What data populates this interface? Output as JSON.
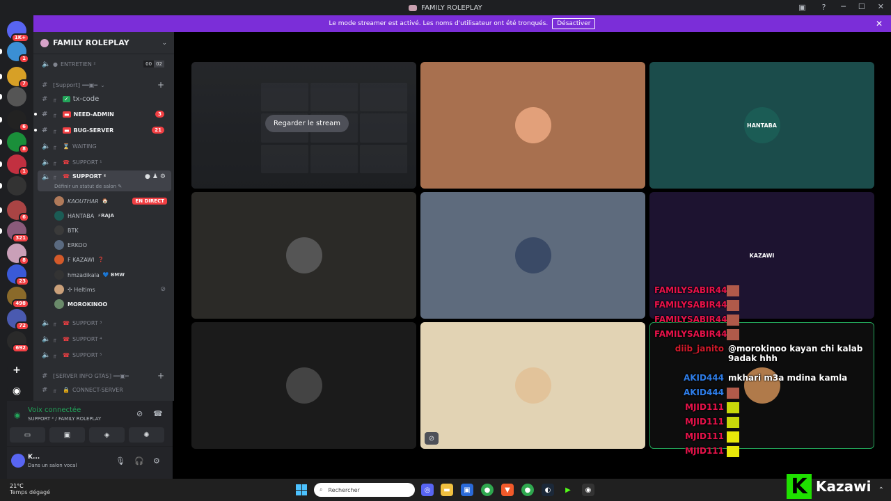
{
  "window": {
    "title": "FAMILY ROLEPLAY"
  },
  "banner": {
    "text": "Le mode streamer est activé. Les noms d'utilisateur ont été tronqués.",
    "button": "Désactiver"
  },
  "rail": {
    "servers": [
      {
        "name": "discord-home",
        "badge": "1K+",
        "color": "#5865f2"
      },
      {
        "name": "server-1",
        "badge": "1",
        "color": "#3b8fd4"
      },
      {
        "name": "server-bn",
        "badge": "7",
        "color": "#d7a026"
      },
      {
        "name": "server-3",
        "badge": "",
        "color": "#555"
      },
      {
        "name": "server-4",
        "badge": "6",
        "color": "#222"
      },
      {
        "name": "server-5",
        "badge": "8",
        "color": "#1a8f3a"
      },
      {
        "name": "server-6",
        "badge": "1",
        "color": "#c23040"
      },
      {
        "name": "server-7",
        "badge": "",
        "color": "#333"
      },
      {
        "name": "server-8",
        "badge": "6",
        "color": "#a44"
      },
      {
        "name": "server-9",
        "badge": "321",
        "color": "#8a5a7a"
      },
      {
        "name": "server-10",
        "badge": "8",
        "color": "#caa0b8"
      },
      {
        "name": "server-11",
        "badge": "23",
        "color": "#3a5ad8"
      },
      {
        "name": "server-12",
        "badge": "498",
        "color": "#8a6a2a"
      },
      {
        "name": "server-13",
        "badge": "72",
        "color": "#4a5ab0"
      },
      {
        "name": "server-14",
        "badge": "692",
        "color": "#2a2a2a"
      }
    ]
  },
  "sidebar": {
    "guild_name": "FAMILY ROLEPLAY",
    "channels": {
      "entretien": "ENTRETIEN ²",
      "entretien_count_a": "00",
      "entretien_count_b": "02",
      "support_category": "⟦Support⟧ ━━▣━",
      "txcode": "tx-code",
      "need_admin": "NEED-ADMIN",
      "need_admin_badge": "3",
      "bug_server": "BUG-SERVER",
      "bug_server_badge": "21",
      "waiting": "WAITING",
      "support1": "SUPPORT ¹",
      "support2": "SUPPORT ²",
      "support2_status": "Définir un statut de salon ✎",
      "support3": "SUPPORT ³",
      "support4": "SUPPORT ⁴",
      "support5": "SUPPORT ⁵",
      "server_info_category": "⟦SERVER INFO GTAS⟧ ━━▣━",
      "connect_server": "CONNECT-SERVER"
    },
    "voice_users": [
      {
        "name": "𝘒𝘈𝘖𝘜𝘛𝘏𝘈𝘙",
        "tag": "🏠",
        "live": "EN DIRECT",
        "color": "#b07a5a"
      },
      {
        "name": "HANTABA",
        "tag": "⚡RAJA",
        "color": "#1b5c55"
      },
      {
        "name": "BTK",
        "tag": "",
        "color": "#3a3a3a"
      },
      {
        "name": "ERKOO",
        "tag": "",
        "color": "#5a6a80"
      },
      {
        "name": "F KAZAWI",
        "tag": "❓",
        "color": "#d45a2a"
      },
      {
        "name": "hmzadikala",
        "tag": "💙 BMW",
        "color": "#333"
      },
      {
        "name": "✣ Heltims",
        "tag": "",
        "color": "#caa07a",
        "muted": true
      },
      {
        "name": "MOROKINOO",
        "tag": "",
        "color": "#6a8a6a",
        "bold": true
      }
    ]
  },
  "voice_panel": {
    "status": "Voix connectée",
    "location": "SUPPORT ² / FAMILY ROLEPLAY"
  },
  "user_panel": {
    "name": "K...",
    "status": "Dans un salon vocal"
  },
  "stage": {
    "watch_stream": "Regarder le stream",
    "tiles": [
      {
        "name": "stream-tile",
        "bg": "#1f2124",
        "avatar": ""
      },
      {
        "name": "kaouthar-tile",
        "bg": "#a8704f",
        "avatar": "#e2a07a"
      },
      {
        "name": "hantaba-tile",
        "bg": "#1b4c4b",
        "avatar": "#1b5c55",
        "label": "HANTABA"
      },
      {
        "name": "btk-tile",
        "bg": "#2b2a27",
        "avatar": "#555"
      },
      {
        "name": "erkoo-tile",
        "bg": "#5e6b7d",
        "avatar": "#3a4a66"
      },
      {
        "name": "kazawi-tile",
        "bg": "#1d1330",
        "avatar": "#d45a2a",
        "label": "KAZAWI"
      },
      {
        "name": "hmzadikala-tile",
        "bg": "#1b1b1b",
        "avatar": "#444"
      },
      {
        "name": "heltims-tile",
        "bg": "#e2d3b4",
        "avatar": "#e2c39a"
      },
      {
        "name": "morokinoo-tile",
        "bg": "#0d0d0d",
        "avatar": "#b07a4a"
      }
    ]
  },
  "chat": [
    {
      "name": "FAMILYSABIR44",
      "color": "#e8124a",
      "msg": ""
    },
    {
      "name": "FAMILYSABIR44",
      "color": "#e8124a",
      "msg": ""
    },
    {
      "name": "FAMILYSABIR44",
      "color": "#e8124a",
      "msg": ""
    },
    {
      "name": "FAMILYSABIR44",
      "color": "#e8124a",
      "msg": ""
    },
    {
      "name": "diib_janito",
      "color": "#d01a2a",
      "msg": "@morokinoo kayan chi kalab 9adak hhh"
    },
    {
      "name": "AKID444",
      "color": "#2e7de8",
      "msg": "mkhari m3a mdina kamla"
    },
    {
      "name": "AKID444",
      "color": "#2e7de8",
      "msg": ""
    },
    {
      "name": "MJID111",
      "color": "#e8124a",
      "msg": ""
    },
    {
      "name": "MJID111",
      "color": "#e8124a",
      "msg": ""
    },
    {
      "name": "MJID111",
      "color": "#e8124a",
      "msg": ""
    },
    {
      "name": "MJID111",
      "color": "#e8124a",
      "msg": ""
    }
  ],
  "taskbar": {
    "temp": "21°C",
    "weather": "Temps dégagé",
    "search": "Rechercher"
  },
  "watermark": {
    "text": "Kazawi",
    "letter": "K"
  }
}
